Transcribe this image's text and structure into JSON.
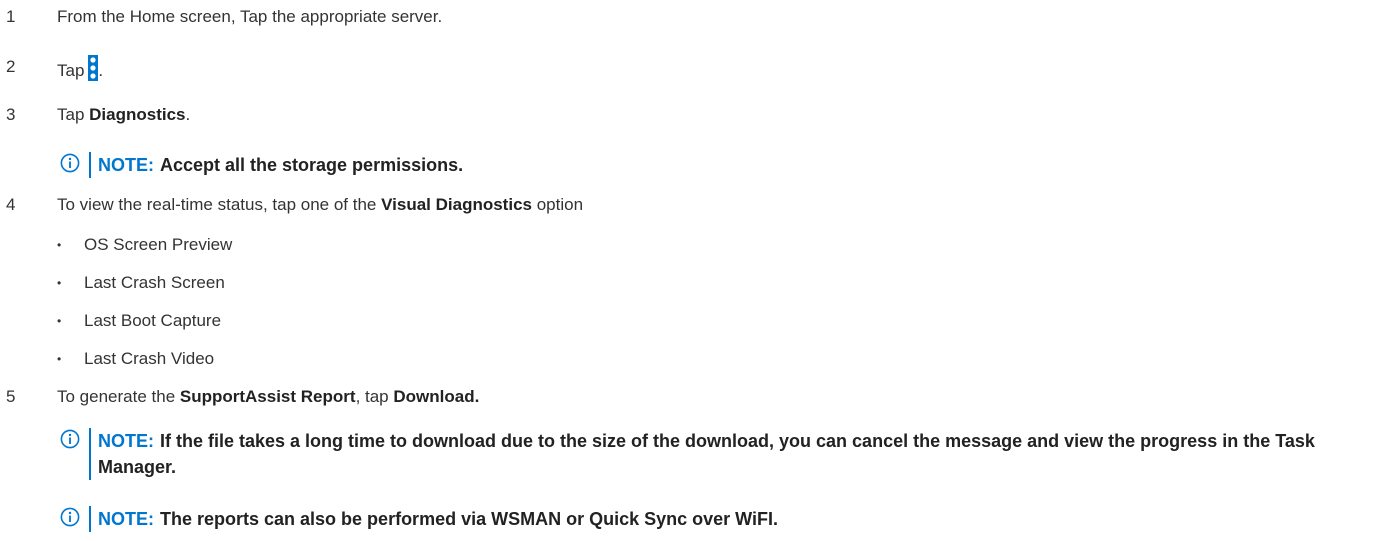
{
  "steps": [
    {
      "num": "1",
      "text": "From the Home screen, Tap the appropriate server."
    },
    {
      "num": "2",
      "pre": "Tap",
      "post": ".",
      "icon": "kebab-menu-icon"
    },
    {
      "num": "3",
      "pre": "Tap ",
      "bold": "Diagnostics",
      "post": "."
    },
    {
      "num": "4",
      "pre": "To view the real-time status, tap one of the ",
      "bold": "Visual Diagnostics",
      "post": " option"
    },
    {
      "num": "5",
      "pre": "To generate the ",
      "bold": "SupportAssist Report",
      "mid": ", tap ",
      "bold2": "Download."
    }
  ],
  "bullets": [
    "OS Screen Preview",
    "Last Crash Screen",
    "Last Boot Capture",
    "Last Crash Video"
  ],
  "notes": [
    {
      "label": "NOTE:",
      "text": "Accept all the storage permissions."
    },
    {
      "label": "NOTE:",
      "text": "If the file takes a long time to download due to the size of the download, you can cancel the message and view the progress in the Task Manager."
    },
    {
      "label": "NOTE:",
      "text": "The reports can also be performed via WSMAN or Quick Sync over WiFI."
    }
  ],
  "bullet_glyph": "•",
  "colors": {
    "accent": "#0076ce",
    "text": "#333333",
    "note_text": "#222222"
  }
}
